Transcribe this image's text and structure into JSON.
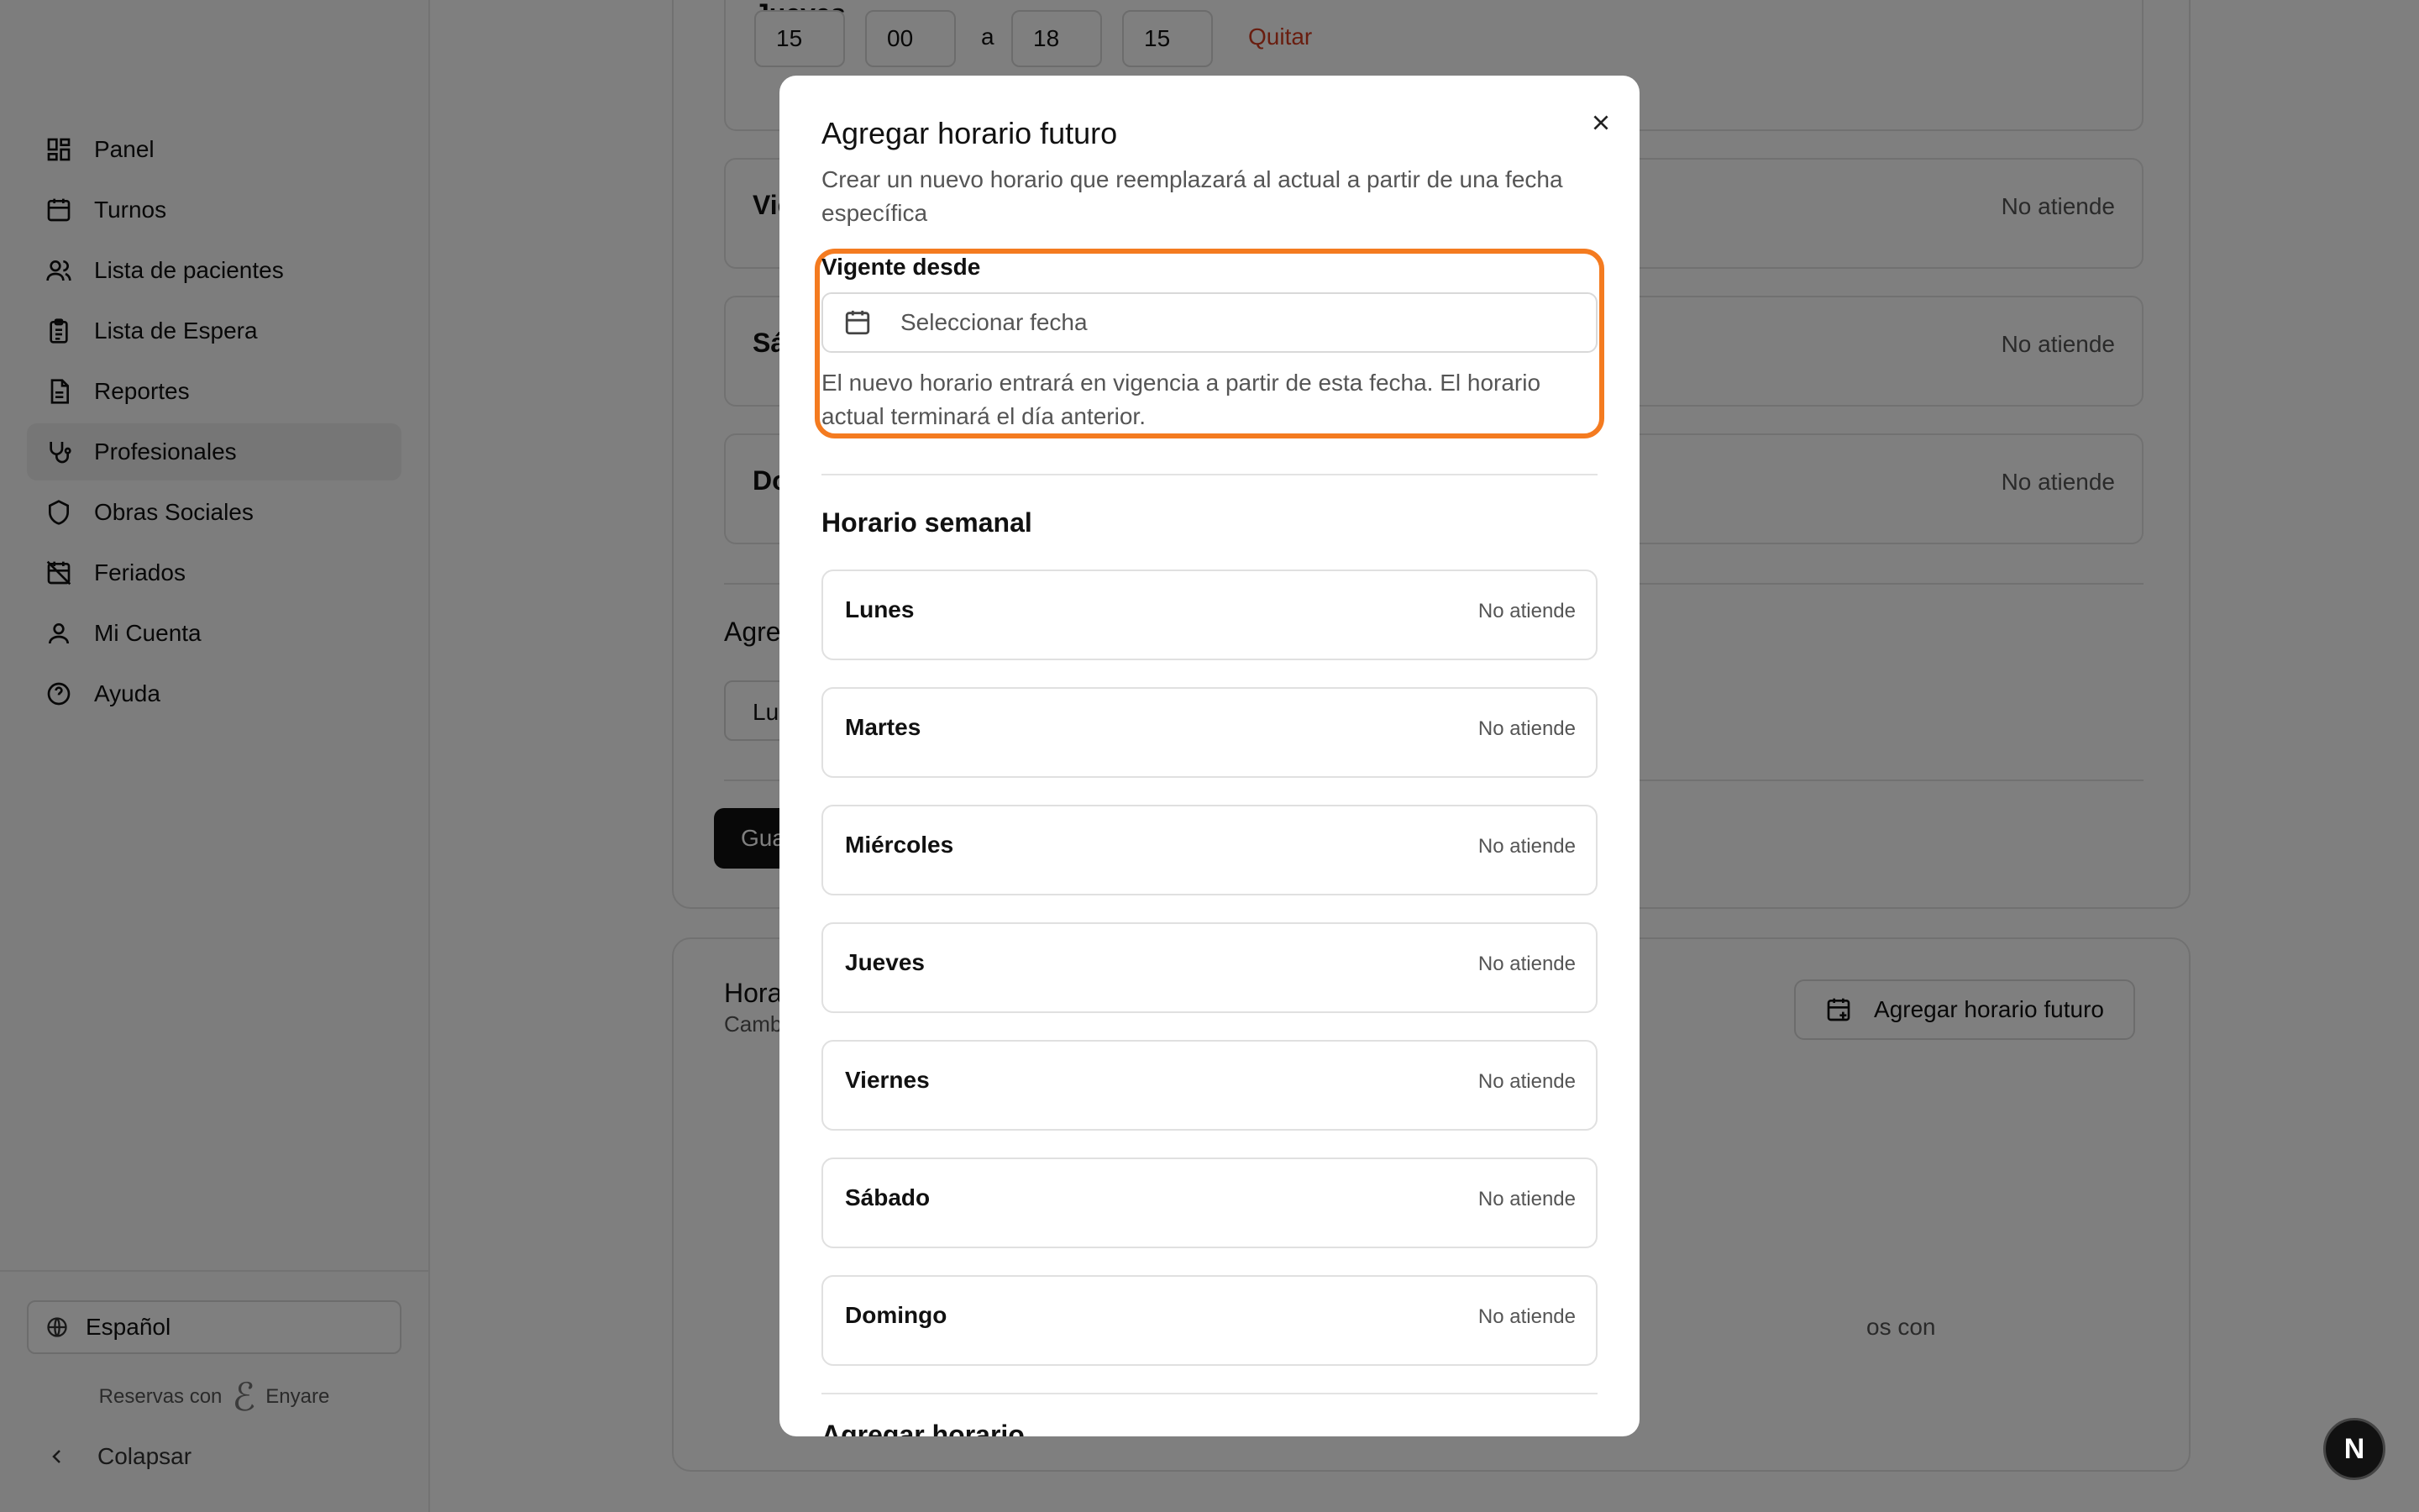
{
  "sidebar": {
    "items": [
      {
        "label": "Panel",
        "icon": "dashboard-icon"
      },
      {
        "label": "Turnos",
        "icon": "calendar-icon"
      },
      {
        "label": "Lista de pacientes",
        "icon": "users-icon"
      },
      {
        "label": "Lista de Espera",
        "icon": "clipboard-icon"
      },
      {
        "label": "Reportes",
        "icon": "report-icon"
      },
      {
        "label": "Profesionales",
        "icon": "stethoscope-icon"
      },
      {
        "label": "Obras Sociales",
        "icon": "shield-icon"
      },
      {
        "label": "Feriados",
        "icon": "calendar-off-icon"
      },
      {
        "label": "Mi Cuenta",
        "icon": "user-icon"
      },
      {
        "label": "Ayuda",
        "icon": "help-icon"
      }
    ],
    "active_item": "Profesionales",
    "language": "Español",
    "powered_by": "Reservas con",
    "brand": "Enyare",
    "collapse_label": "Colapsar"
  },
  "background": {
    "jueves_label": "Jueves",
    "from_hour": "15",
    "from_min": "00",
    "a_label": "a",
    "to_hour": "18",
    "to_min": "15",
    "remove_label": "Quitar",
    "rows": [
      {
        "label": "Vie",
        "status": "No atiende"
      },
      {
        "label": "Sáb",
        "status": "No atiende"
      },
      {
        "label": "Do",
        "status": "No atiende"
      }
    ],
    "add_label": "Agreg",
    "select_value": "Lun",
    "save_label": "Gua",
    "future_title": "Horar",
    "future_sub": "Cambi",
    "future_button": "Agregar horario futuro",
    "fragment_text": "os con"
  },
  "modal": {
    "title": "Agregar horario futuro",
    "subtitle": "Crear un nuevo horario que reemplazará al actual a partir de una fecha específica",
    "effective_label": "Vigente desde",
    "date_placeholder": "Seleccionar fecha",
    "effective_help": "El nuevo horario entrará en vigencia a partir de esta fecha. El horario actual terminará el día anterior.",
    "weekly_title": "Horario semanal",
    "days": [
      {
        "label": "Lunes",
        "status": "No atiende"
      },
      {
        "label": "Martes",
        "status": "No atiende"
      },
      {
        "label": "Miércoles",
        "status": "No atiende"
      },
      {
        "label": "Jueves",
        "status": "No atiende"
      },
      {
        "label": "Viernes",
        "status": "No atiende"
      },
      {
        "label": "Sábado",
        "status": "No atiende"
      },
      {
        "label": "Domingo",
        "status": "No atiende"
      }
    ],
    "next_section_partial": "Agregar horario"
  },
  "dev_badge": "N",
  "colors": {
    "highlight": "#f47b20",
    "danger": "#d23b1f",
    "overlay": "rgba(0,0,0,0.5)"
  }
}
